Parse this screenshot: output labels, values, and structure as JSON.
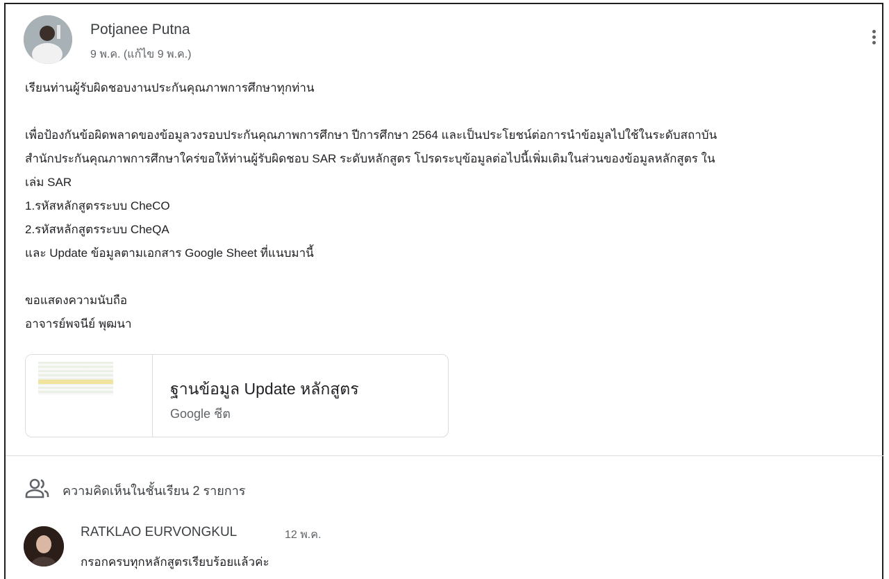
{
  "post": {
    "author": "Potjanee Putna",
    "date": "9 พ.ค. (แก้ไข 9 พ.ค.)",
    "greeting": "เรียนท่านผู้รับผิดชอบงานประกันคุณภาพการศึกษาทุกท่าน",
    "line1": "เพื่อป้องกันข้อผิดพลาดของข้อมูลวงรอบประกันคุณภาพการศึกษา ปีการศึกษา 2564 และเป็นประโยชน์ต่อการนำข้อมูลไปใช้ในระดับสถาบัน",
    "line2": "สำนักประกันคุณภาพการศึกษาใคร่ขอให้ท่านผู้รับผิดชอบ SAR ระดับหลักสูตร โปรดระบุข้อมูลต่อไปนี้เพิ่มเติมในส่วนของข้อมูลหลักสูตร ใน",
    "line3": "เล่ม SAR",
    "item1": "1.รหัสหลักสูตรระบบ CheCO",
    "item2": "2.รหัสหลักสูตรระบบ CheQA",
    "line4": "และ Update ข้อมูลตามเอกสาร Google Sheet ที่แนบมานี้",
    "closing": "ขอแสดงความนับถือ",
    "signature": "อาจารย์พจนีย์  พุฒนา"
  },
  "attachment": {
    "title": "ฐานข้อมูล Update หลักสูตร",
    "type": "Google ชีต"
  },
  "comments": {
    "label": "ความคิดเห็นในชั้นเรียน 2 รายการ",
    "items": [
      {
        "author": "RATKLAO EURVONGKUL",
        "date": "12 พ.ค.",
        "text": "กรอกครบทุกหลักสูตรเรียบร้อยแล้วค่ะ"
      }
    ]
  },
  "icons": {
    "more": "more-vert-icon",
    "people": "people-icon"
  }
}
